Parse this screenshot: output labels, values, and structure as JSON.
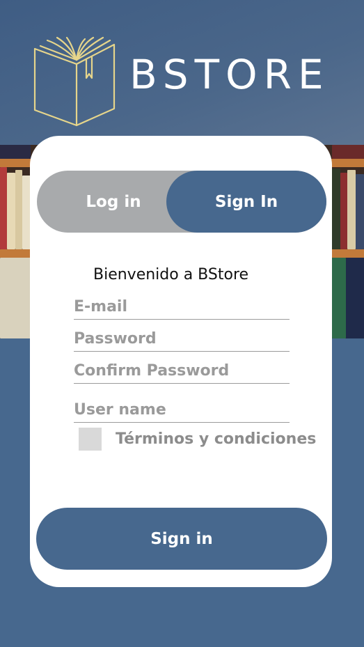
{
  "header": {
    "brand": "BSTORE",
    "logo_icon": "open-book-icon"
  },
  "tabs": {
    "login_label": "Log in",
    "signin_label": "Sign In",
    "active": "signin"
  },
  "form": {
    "welcome": "Bienvenido a BStore",
    "email_placeholder": "E-mail",
    "password_placeholder": "Password",
    "confirm_password_placeholder": "Confirm Password",
    "username_placeholder": "User name",
    "terms_label": "Términos y condiciones",
    "terms_checked": false,
    "submit_label": "Sign in"
  },
  "colors": {
    "primary": "#47688e",
    "inactive_tab": "#a8aaac",
    "placeholder": "#9a9a9a",
    "logo_gold": "#e6d58b"
  }
}
